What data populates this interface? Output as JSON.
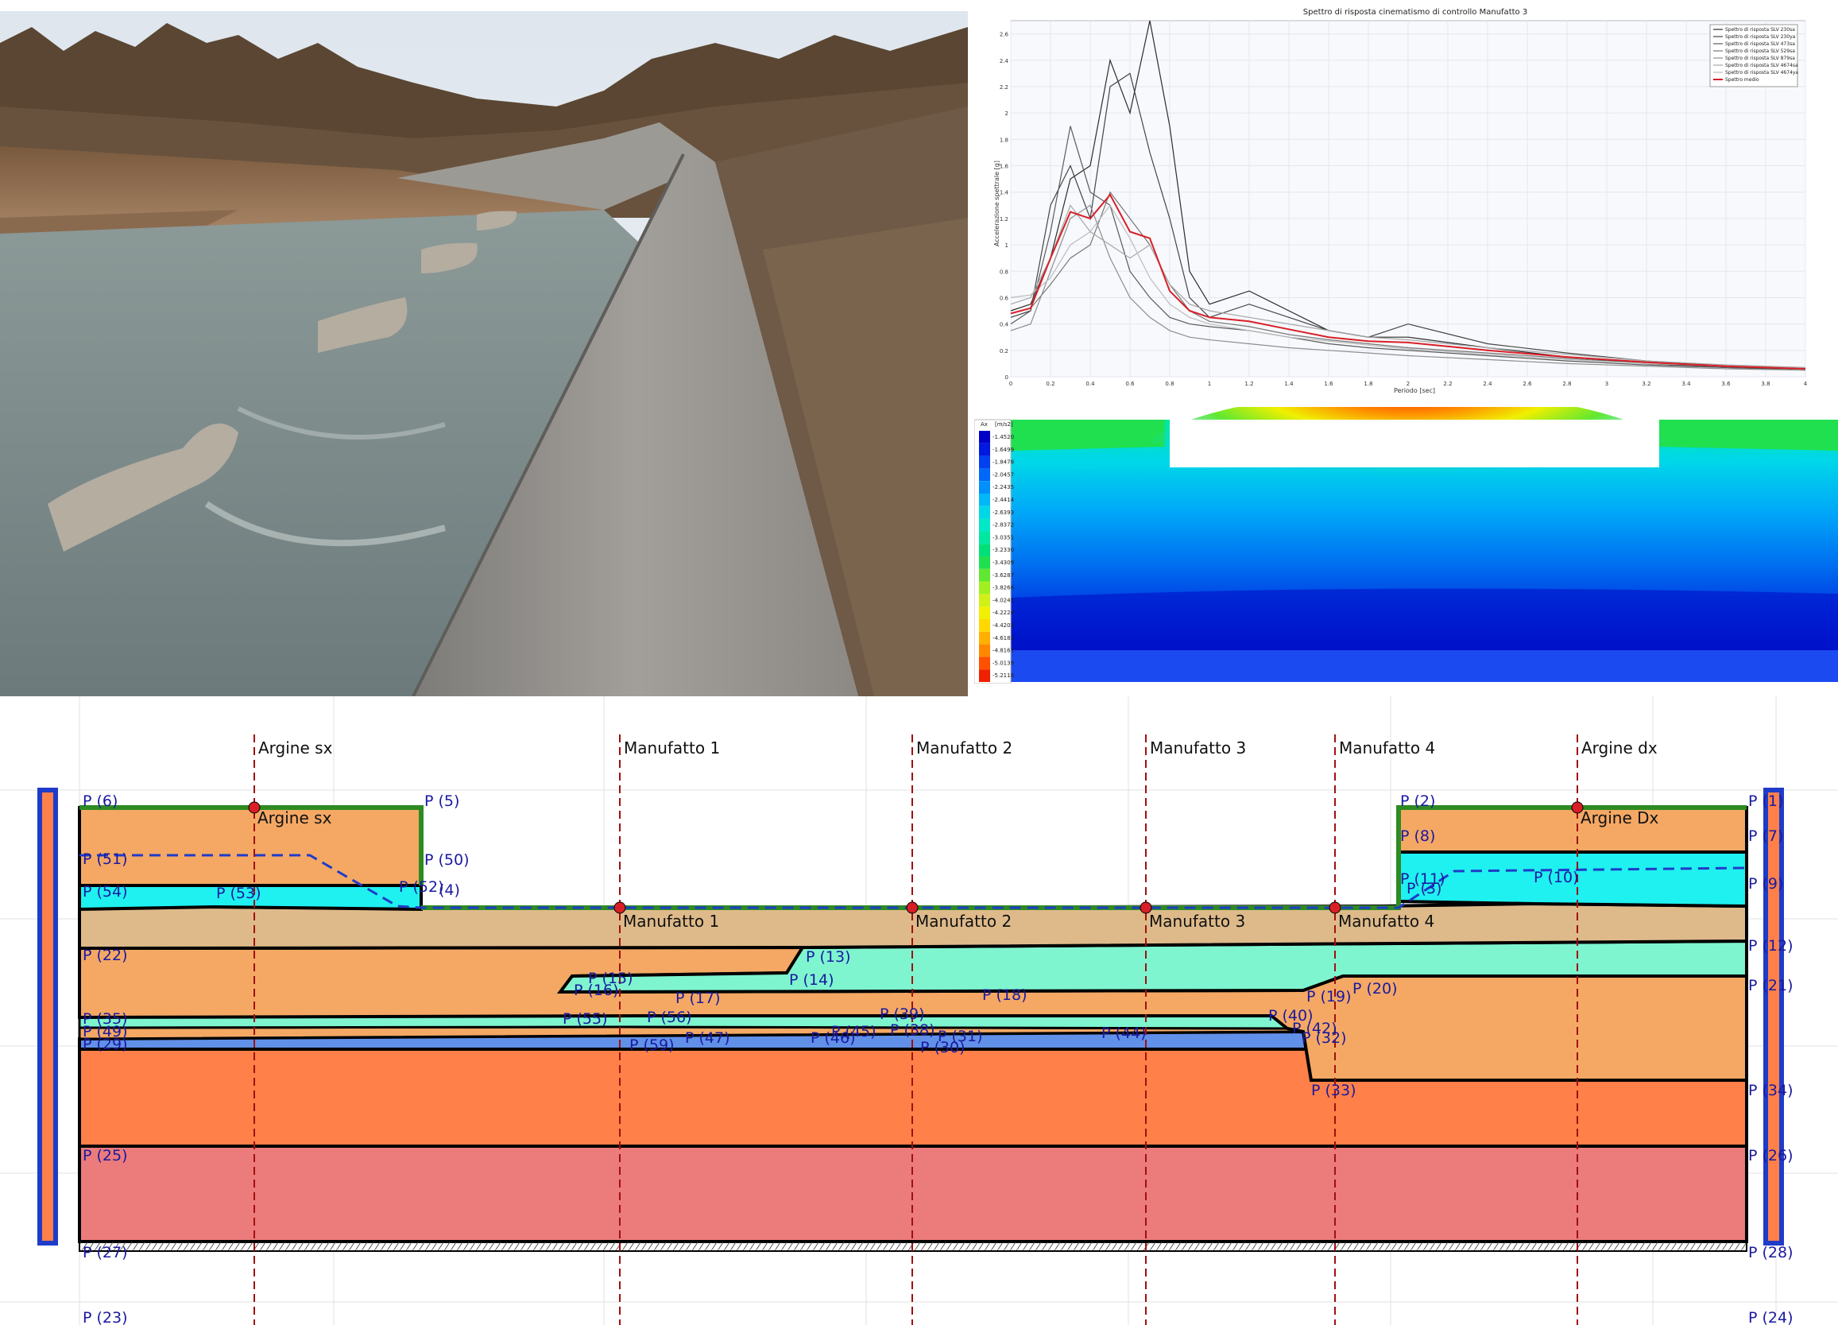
{
  "spectrum": {
    "title": "Spettro di risposta cinematismo di controllo Manufatto 3",
    "xlabel": "Periodo [sec]",
    "ylabel": "Accelerazione spettrale [g]",
    "legend": [
      "Spettro di risposta SLV 230sa",
      "Spettro di risposta SLV 230ya",
      "Spettro di risposta SLV 473sa",
      "Spettro di risposta SLV 529sa",
      "Spettro di risposta SLV 879sa",
      "Spettro di risposta SLV 4674sa",
      "Spettro di risposta SLV 4674ya",
      "Spettro medio"
    ],
    "colors": {
      "records": "#555555",
      "mean": "#d81f26"
    }
  },
  "chart_data": {
    "type": "line",
    "title": "Spettro di risposta cinematismo di controllo Manufatto 3",
    "xlabel": "Periodo [sec]",
    "ylabel": "Accelerazione spettrale [g]",
    "xlim": [
      0,
      4
    ],
    "ylim": [
      0,
      2.7
    ],
    "xticks": [
      "0",
      "0.2",
      "0.4",
      "0.6",
      "0.8",
      "1",
      "1.2",
      "1.4",
      "1.6",
      "1.8",
      "2",
      "2.2",
      "2.4",
      "2.6",
      "2.8",
      "3",
      "3.2",
      "3.4",
      "3.6",
      "3.8",
      "4"
    ],
    "yticks": [
      "0",
      "0.2",
      "0.4",
      "0.6",
      "0.8",
      "1",
      "1.2",
      "1.4",
      "1.6",
      "1.8",
      "2",
      "2.2",
      "2.4",
      "2.6"
    ],
    "x": [
      0,
      0.1,
      0.2,
      0.3,
      0.4,
      0.5,
      0.6,
      0.7,
      0.8,
      0.9,
      1.0,
      1.2,
      1.4,
      1.6,
      1.8,
      2.0,
      2.4,
      2.8,
      3.2,
      3.6,
      4.0
    ],
    "series": [
      {
        "name": "Spettro di risposta SLV 230sa",
        "values": [
          0.5,
          0.55,
          0.9,
          1.5,
          1.6,
          2.4,
          2.0,
          2.7,
          1.9,
          0.8,
          0.55,
          0.65,
          0.5,
          0.35,
          0.3,
          0.3,
          0.22,
          0.15,
          0.1,
          0.07,
          0.06
        ]
      },
      {
        "name": "Spettro di risposta SLV 230ya",
        "values": [
          0.45,
          0.5,
          1.3,
          1.6,
          1.2,
          2.2,
          2.3,
          1.7,
          1.2,
          0.6,
          0.45,
          0.55,
          0.45,
          0.35,
          0.3,
          0.4,
          0.25,
          0.18,
          0.12,
          0.08,
          0.06
        ]
      },
      {
        "name": "Spettro di risposta SLV 473sa",
        "values": [
          0.4,
          0.5,
          1.1,
          1.9,
          1.4,
          1.3,
          0.8,
          0.6,
          0.45,
          0.4,
          0.38,
          0.35,
          0.3,
          0.25,
          0.22,
          0.2,
          0.16,
          0.12,
          0.09,
          0.07,
          0.05
        ]
      },
      {
        "name": "Spettro di risposta SLV 529sa",
        "values": [
          0.48,
          0.52,
          0.7,
          0.9,
          1.0,
          1.4,
          1.2,
          1.0,
          0.7,
          0.5,
          0.42,
          0.38,
          0.32,
          0.28,
          0.25,
          0.22,
          0.18,
          0.14,
          0.1,
          0.08,
          0.06
        ]
      },
      {
        "name": "Spettro di risposta SLV 879sa",
        "values": [
          0.35,
          0.4,
          0.8,
          1.2,
          1.3,
          0.9,
          0.6,
          0.45,
          0.35,
          0.3,
          0.28,
          0.25,
          0.22,
          0.2,
          0.18,
          0.16,
          0.13,
          0.1,
          0.08,
          0.06,
          0.05
        ]
      },
      {
        "name": "Spettro di risposta SLV 4674sa",
        "values": [
          0.55,
          0.6,
          0.9,
          1.3,
          1.1,
          1.0,
          0.9,
          1.0,
          0.7,
          0.55,
          0.5,
          0.45,
          0.4,
          0.35,
          0.3,
          0.28,
          0.22,
          0.17,
          0.12,
          0.09,
          0.07
        ]
      },
      {
        "name": "Spettro di risposta SLV 4674ya",
        "values": [
          0.6,
          0.62,
          0.75,
          1.0,
          1.1,
          1.3,
          1.05,
          0.75,
          0.55,
          0.45,
          0.4,
          0.35,
          0.3,
          0.27,
          0.24,
          0.21,
          0.17,
          0.13,
          0.1,
          0.08,
          0.06
        ]
      },
      {
        "name": "Spettro medio",
        "values": [
          0.48,
          0.52,
          0.9,
          1.25,
          1.2,
          1.38,
          1.1,
          1.05,
          0.65,
          0.5,
          0.45,
          0.42,
          0.36,
          0.3,
          0.27,
          0.26,
          0.2,
          0.15,
          0.11,
          0.08,
          0.06
        ]
      }
    ]
  },
  "contour": {
    "legend_title": "Ax",
    "legend_unit": "[m/s2]",
    "legend_values": [
      "-1.4520",
      "-1.6499",
      "-1.8478",
      "-2.0457",
      "-2.2435",
      "-2.4414",
      "-2.6393",
      "-2.8372",
      "-3.0351",
      "-3.2330",
      "-3.4309",
      "-3.6287",
      "-3.8266",
      "-4.0245",
      "-4.2224",
      "-4.4203",
      "-4.6182",
      "-4.8161",
      "-5.0139",
      "-5.2118"
    ],
    "legend_colors": [
      "#0000c8",
      "#0018e0",
      "#0040f0",
      "#0068f8",
      "#0090fc",
      "#00b8f8",
      "#00d8e8",
      "#00e8c8",
      "#00e8a0",
      "#00e078",
      "#20e050",
      "#60e830",
      "#a0f020",
      "#d0f018",
      "#f0f000",
      "#ffd800",
      "#ffb000",
      "#ff8800",
      "#ff5000",
      "#f02000"
    ]
  },
  "section": {
    "top_labels": [
      "Argine sx",
      "Manufatto 1",
      "Manufatto 2",
      "Manufatto 3",
      "Manufatto 4",
      "Argine dx"
    ],
    "marker_labels": [
      "Argine sx",
      "Manufatto 1",
      "Manufatto 2",
      "Manufatto 3",
      "Manufatto 4",
      "Argine Dx"
    ],
    "colors": {
      "orange": "#f4a864",
      "tan": "#deba8a",
      "cyan": "#1ff0f0",
      "aqua": "#7ef5cf",
      "blue": "#6190e8",
      "orange2": "#ff8048",
      "pink": "#ec7b7b",
      "outline": "#000000",
      "green": "#2e8b22",
      "water": "#1f3cc8",
      "marker": "#d81f26"
    },
    "points": [
      {
        "label": "P (6)"
      },
      {
        "label": "P (5)"
      },
      {
        "label": "P (51)"
      },
      {
        "label": "P (50)"
      },
      {
        "label": "P (54)"
      },
      {
        "label": "P (53)"
      },
      {
        "label": "P (52)"
      },
      {
        "label": "(4)"
      },
      {
        "label": "P (22)"
      },
      {
        "label": "P (35)"
      },
      {
        "label": "P (49)"
      },
      {
        "label": "P (29)"
      },
      {
        "label": "P (25)"
      },
      {
        "label": "P (27)"
      },
      {
        "label": "P (23)"
      },
      {
        "label": "P (13)"
      },
      {
        "label": "P (15)"
      },
      {
        "label": "P (14)"
      },
      {
        "label": "P (16)"
      },
      {
        "label": "P (17)"
      },
      {
        "label": "P (18)"
      },
      {
        "label": "P (55)"
      },
      {
        "label": "P (56)"
      },
      {
        "label": "P (59)"
      },
      {
        "label": "P (47)"
      },
      {
        "label": "P (46)"
      },
      {
        "label": "P (45)"
      },
      {
        "label": "P (39)"
      },
      {
        "label": "P (38)"
      },
      {
        "label": "P (31)"
      },
      {
        "label": "P (30)"
      },
      {
        "label": "P (44)"
      },
      {
        "label": "P (40)"
      },
      {
        "label": "P (42)"
      },
      {
        "label": "P (32)"
      },
      {
        "label": "P (33)"
      },
      {
        "label": "P (19)"
      },
      {
        "label": "P (20)"
      },
      {
        "label": "P (2)"
      },
      {
        "label": "P (1)"
      },
      {
        "label": "P (8)"
      },
      {
        "label": "P (7)"
      },
      {
        "label": "P (11)"
      },
      {
        "label": "P (3)"
      },
      {
        "label": "P (10)"
      },
      {
        "label": "P (9)"
      },
      {
        "label": "P (12)"
      },
      {
        "label": "P (21)"
      },
      {
        "label": "P (34)"
      },
      {
        "label": "P (26)"
      },
      {
        "label": "P (28)"
      },
      {
        "label": "P (24)"
      }
    ]
  }
}
